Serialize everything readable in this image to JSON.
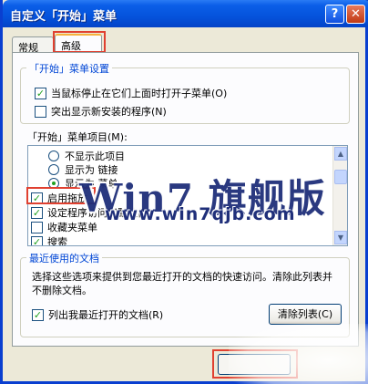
{
  "window": {
    "title": "自定义「开始」菜单",
    "help_glyph": "?",
    "close_glyph": "✕"
  },
  "tabs": [
    {
      "label": "常规",
      "selected": false
    },
    {
      "label": "高级",
      "selected": true
    }
  ],
  "start_menu_settings": {
    "legend": "「开始」菜单设置",
    "options": [
      {
        "label": "当鼠标停止在它们上面时打开子菜单(O)",
        "checked": true
      },
      {
        "label": "突出显示新安装的程序(N)",
        "checked": false
      }
    ]
  },
  "start_menu_items": {
    "legend": "「开始」菜单项目(M):",
    "items": [
      {
        "type": "radio",
        "label": "不显示此项目",
        "checked": false
      },
      {
        "type": "radio",
        "label": "显示为 链接",
        "checked": false
      },
      {
        "type": "radio",
        "label": "显示为 菜单",
        "checked": true
      },
      {
        "type": "checkbox",
        "label": "启用拖放",
        "checked": true
      },
      {
        "type": "checkbox",
        "label": "设定程序访问和默认值",
        "checked": true
      },
      {
        "type": "checkbox",
        "label": "收藏夹菜单",
        "checked": false
      },
      {
        "type": "checkbox",
        "label": "搜索",
        "checked": true
      }
    ]
  },
  "recent_docs": {
    "legend": "最近使用的文档",
    "description": "选择这些选项来提供到您最近打开的文档的快速访问。清除此列表并不删除文档。",
    "list_recent_label": "列出我最近打开的文档(R)",
    "list_recent_checked": true,
    "clear_list_label": "清除列表(C)"
  },
  "watermark": {
    "brand": "Win7 旗舰版",
    "url": "www.win7qjb.com"
  },
  "colors": {
    "title_blue": "#0553dc",
    "highlight_red": "#e04030",
    "legend_blue": "#0046d5"
  }
}
